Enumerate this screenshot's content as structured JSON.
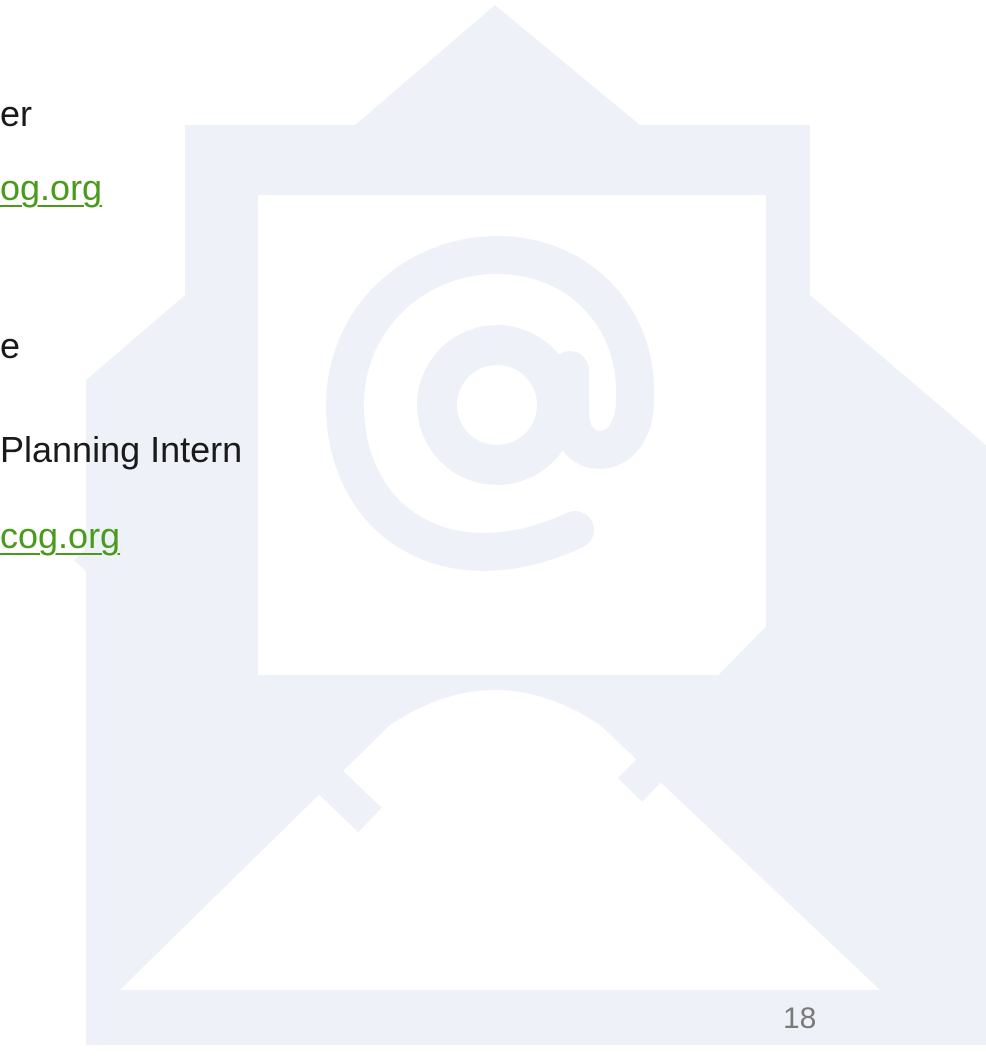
{
  "contacts": [
    {
      "title_fragment": "er",
      "email_fragment": "og.org"
    },
    {
      "name_fragment": "e",
      "title_fragment": "Planning Intern",
      "email_fragment": "cog.org"
    }
  ],
  "slide_number": "18",
  "background_icon": "envelope-at-icon",
  "colors": {
    "link": "#4a9a1c",
    "text": "#1a1a1a",
    "icon": "#eef1f8",
    "page_number": "#7a7a7a"
  }
}
